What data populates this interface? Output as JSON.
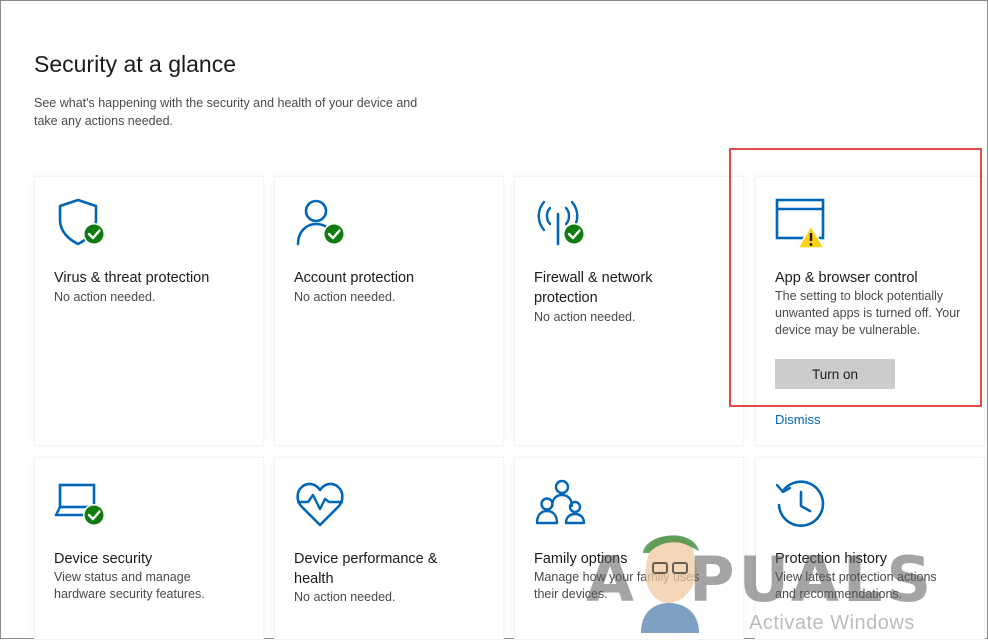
{
  "header": {
    "title": "Security at a glance",
    "subtitle": "See what's happening with the security and health of your device and take any actions needed."
  },
  "tiles": [
    {
      "title": "Virus & threat protection",
      "desc": "No action needed.",
      "icon": "shield-check-icon",
      "status": "ok"
    },
    {
      "title": "Account protection",
      "desc": "No action needed.",
      "icon": "person-check-icon",
      "status": "ok"
    },
    {
      "title": "Firewall & network protection",
      "desc": "No action needed.",
      "icon": "wifi-tower-check-icon",
      "status": "ok"
    },
    {
      "title": "App & browser control",
      "desc": "The setting to block potentially unwanted apps is turned off. Your device may be vulnerable.",
      "icon": "browser-window-warning-icon",
      "status": "warning"
    },
    {
      "title": "Device security",
      "desc": "View status and manage hardware security features.",
      "icon": "laptop-check-icon",
      "status": "ok"
    },
    {
      "title": "Device performance & health",
      "desc": "No action needed.",
      "icon": "heart-pulse-icon",
      "status": "info"
    },
    {
      "title": "Family options",
      "desc": "Manage how your family uses their devices.",
      "icon": "family-icon",
      "status": "info"
    },
    {
      "title": "Protection history",
      "desc": "View latest protection actions and recommendations.",
      "icon": "history-clock-icon",
      "status": "info"
    }
  ],
  "actions": {
    "turn_on_label": "Turn on",
    "dismiss_label": "Dismiss"
  },
  "watermark": {
    "activate": "Activate Windows",
    "logo": "APPUALS"
  },
  "colors": {
    "accent": "#0067b8",
    "ok_green": "#107c10",
    "warning_yellow": "#fcd116",
    "highlight_red": "#e24a4a"
  }
}
